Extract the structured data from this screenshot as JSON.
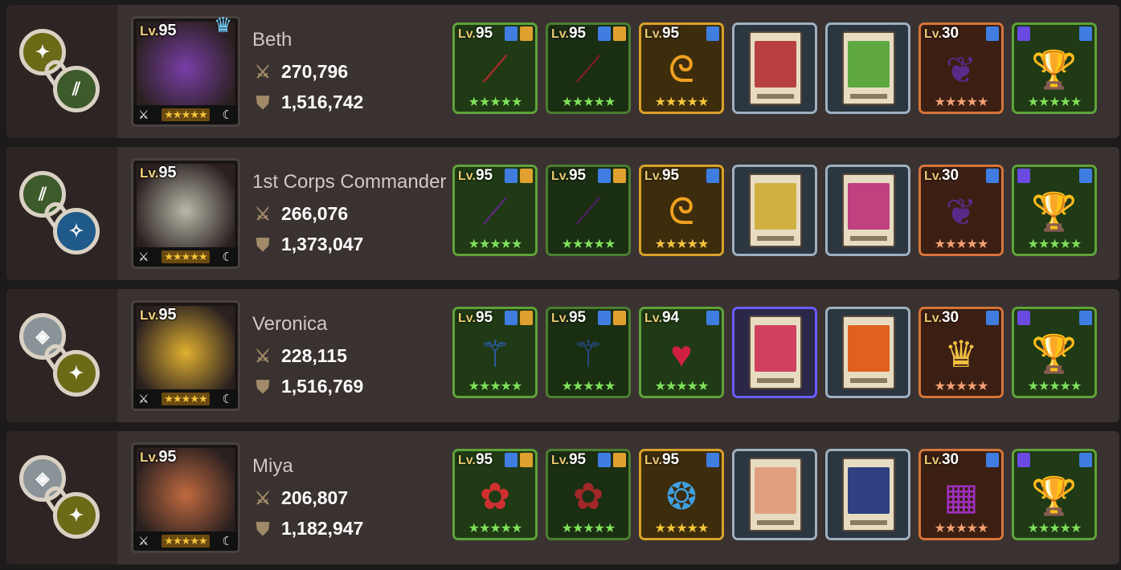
{
  "heroes": [
    {
      "name": "Beth",
      "level": "95",
      "attack": "270,796",
      "defense": "1,516,742",
      "crown": true,
      "chain_elements": [
        "olive",
        "green"
      ],
      "portrait_color": "#7a3ea8",
      "equipment": [
        {
          "type": "green",
          "level": "95",
          "tags": 2,
          "icon": "crimson-blade-icon",
          "color": "#a82a2a"
        },
        {
          "type": "green dim",
          "level": "95",
          "tags": 2,
          "icon": "crimson-blade-icon",
          "color": "#7a2020"
        },
        {
          "type": "gold",
          "level": "95",
          "tags": 1,
          "icon": "gold-ring-icon",
          "color": "#f0a020"
        },
        {
          "type": "card",
          "level": "",
          "icon": "hero-card-icon",
          "color": "#b84040"
        },
        {
          "type": "card",
          "level": "",
          "icon": "spear-card-icon",
          "color": "#5fa840"
        },
        {
          "type": "orange",
          "level": "30",
          "tags": 1,
          "icon": "dark-wings-icon",
          "color": "#5a2a8a"
        },
        {
          "type": "green",
          "level": "",
          "tags": "lr",
          "icon": "red-chalice-icon",
          "color": "#c0a090"
        }
      ]
    },
    {
      "name": "1st Corps Commander",
      "level": "95",
      "attack": "266,076",
      "defense": "1,373,047",
      "crown": false,
      "chain_elements": [
        "green",
        "blue"
      ],
      "portrait_color": "#b8b8a8",
      "equipment": [
        {
          "type": "green",
          "level": "95",
          "tags": 2,
          "icon": "dark-spear-icon",
          "color": "#5a2a7a"
        },
        {
          "type": "green dim",
          "level": "95",
          "tags": 2,
          "icon": "dark-spear-icon",
          "color": "#4a2060"
        },
        {
          "type": "gold",
          "level": "95",
          "tags": 1,
          "icon": "gold-ring-icon",
          "color": "#f0a020"
        },
        {
          "type": "card",
          "level": "",
          "icon": "hero-card-icon",
          "color": "#d0b040"
        },
        {
          "type": "card",
          "level": "",
          "icon": "hero-card-icon",
          "color": "#c04080"
        },
        {
          "type": "orange",
          "level": "30",
          "tags": 1,
          "icon": "dark-wings-icon",
          "color": "#5a2a8a"
        },
        {
          "type": "green",
          "level": "",
          "tags": "lr",
          "icon": "red-chalice-icon",
          "color": "#c0a090"
        }
      ]
    },
    {
      "name": "Veronica",
      "level": "95",
      "attack": "228,115",
      "defense": "1,516,769",
      "crown": false,
      "chain_elements": [
        "gray",
        "olive"
      ],
      "portrait_color": "#e0b030",
      "equipment": [
        {
          "type": "green",
          "level": "95",
          "tags": 2,
          "icon": "blue-staff-icon",
          "color": "#3060c0"
        },
        {
          "type": "green dim",
          "level": "95",
          "tags": 2,
          "icon": "blue-staff-icon",
          "color": "#284e98"
        },
        {
          "type": "green",
          "level": "94",
          "tags": 1,
          "icon": "ruby-necklace-icon",
          "color": "#d02040"
        },
        {
          "type": "card purple",
          "level": "",
          "icon": "hero-card-icon",
          "color": "#d04060"
        },
        {
          "type": "card",
          "level": "",
          "icon": "food-card-icon",
          "color": "#e06020"
        },
        {
          "type": "orange",
          "level": "30",
          "tags": 1,
          "icon": "costume-doll-icon",
          "color": "#f0c040"
        },
        {
          "type": "green",
          "level": "",
          "tags": "lr",
          "icon": "red-chalice-icon",
          "color": "#c0a090"
        }
      ]
    },
    {
      "name": "Miya",
      "level": "95",
      "attack": "206,807",
      "defense": "1,182,947",
      "crown": false,
      "chain_elements": [
        "gray",
        "olive"
      ],
      "portrait_color": "#c06a40",
      "equipment": [
        {
          "type": "green",
          "level": "95",
          "tags": 2,
          "icon": "red-fan-icon",
          "color": "#d03030"
        },
        {
          "type": "green dim",
          "level": "95",
          "tags": 2,
          "icon": "red-fan-icon",
          "color": "#a02828"
        },
        {
          "type": "gold",
          "level": "95",
          "tags": 1,
          "icon": "blue-earring-icon",
          "color": "#40a0e0"
        },
        {
          "type": "card",
          "level": "",
          "icon": "hero-card-icon",
          "color": "#e0a080"
        },
        {
          "type": "card",
          "level": "",
          "icon": "witch-card-icon",
          "color": "#304080"
        },
        {
          "type": "orange",
          "level": "30",
          "tags": 1,
          "icon": "arcade-machine-icon",
          "color": "#a030c0"
        },
        {
          "type": "green",
          "level": "",
          "tags": "lr",
          "icon": "red-chalice-icon",
          "color": "#c0a090"
        }
      ]
    }
  ],
  "labels": {
    "lv": "Lv."
  },
  "icons": {
    "attack": "crossed-swords-icon",
    "defense": "shield-icon",
    "crown": "crown-icon"
  }
}
